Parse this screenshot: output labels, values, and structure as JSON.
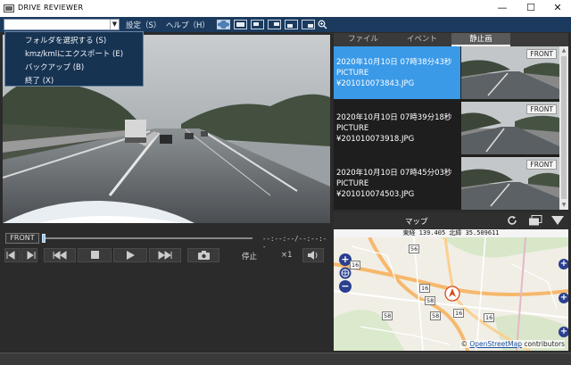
{
  "window": {
    "title": "DRIVE REVIEWER",
    "minimize": "—",
    "maximize": "☐",
    "close": "✕"
  },
  "menu": {
    "combo_value": "",
    "settings": "設定（S）",
    "help": "ヘルプ（H）"
  },
  "dropdown": {
    "items": [
      "フォルダを選択する (S)",
      "kmz/kmlにエクスポート (E)",
      "バックアップ (B)",
      "終了 (X)"
    ]
  },
  "player": {
    "camera_label": "FRONT",
    "time": "--:--:--/--:--:--",
    "status": "停止",
    "speed": "×1",
    "progress": 0.0
  },
  "tabs": [
    {
      "label": "ファイル",
      "active": false
    },
    {
      "label": "イベント",
      "active": false
    },
    {
      "label": "静止画",
      "active": true
    }
  ],
  "list": [
    {
      "datetime": "2020年10月10日 07時38分43秒",
      "type": "PICTURE",
      "file": "¥201010073843.JPG",
      "camera": "FRONT",
      "selected": true
    },
    {
      "datetime": "2020年10月10日 07時39分18秒",
      "type": "PICTURE",
      "file": "¥201010073918.JPG",
      "camera": "FRONT",
      "selected": false
    },
    {
      "datetime": "2020年10月10日 07時45分03秒",
      "type": "PICTURE",
      "file": "¥201010074503.JPG",
      "camera": "FRONT",
      "selected": false
    }
  ],
  "map": {
    "title": "マップ",
    "coords": "東経 139.405 北緯 35.509611",
    "attribution_prefix": "© ",
    "attribution_link": "OpenStreetMap",
    "attribution_suffix": " contributors",
    "route_numbers": [
      "56",
      "16",
      "16",
      "58",
      "58",
      "58",
      "16",
      "16"
    ]
  },
  "colors": {
    "menubar": "#1b3a5e",
    "selection": "#3a9ae8",
    "background": "#2b2b2b"
  }
}
